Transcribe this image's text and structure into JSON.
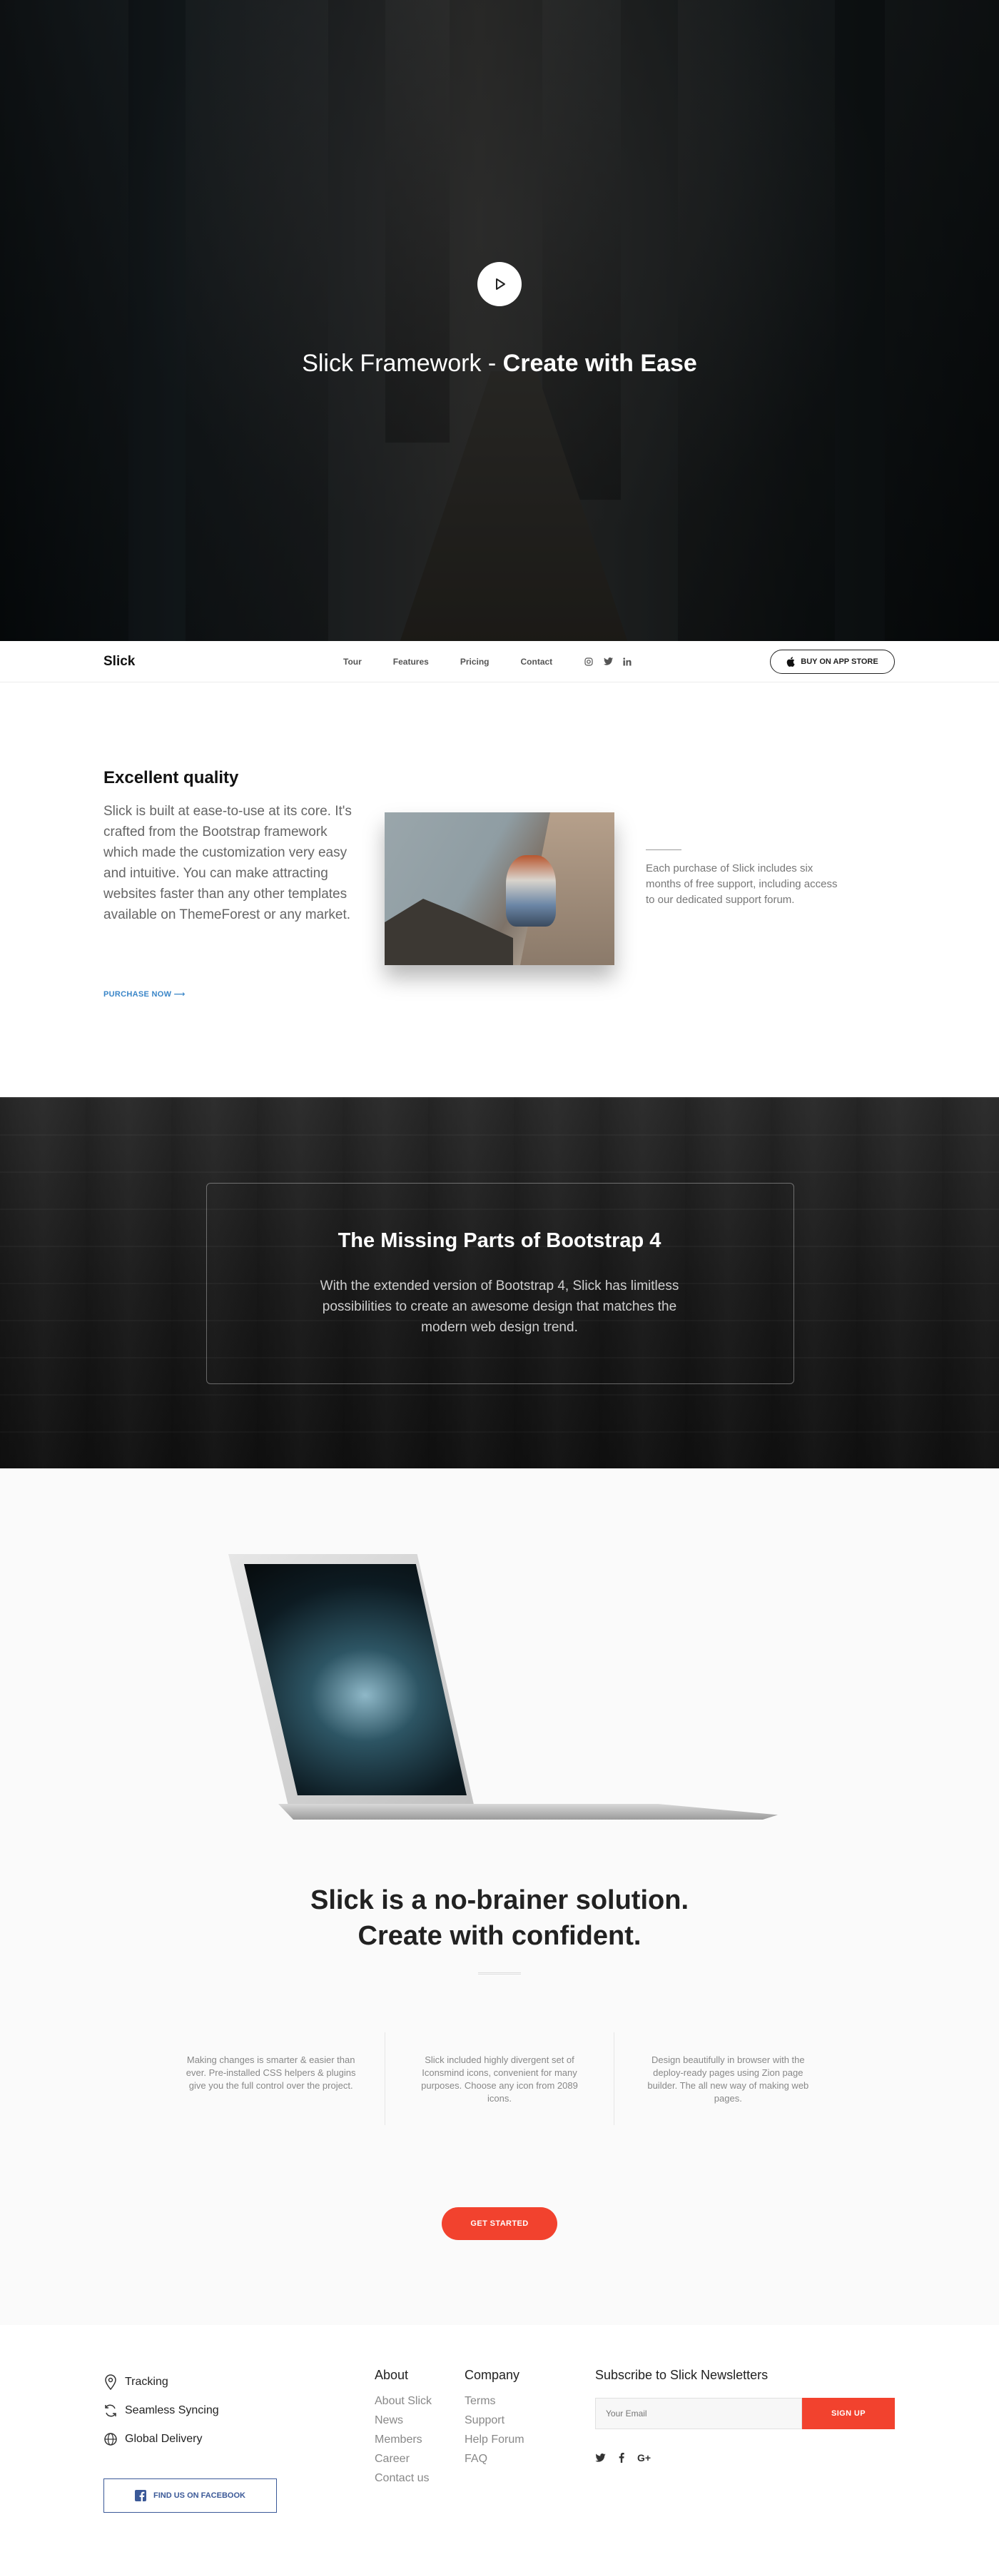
{
  "hero": {
    "title_light": "Slick Framework - ",
    "title_bold": "Create with Ease",
    "play_icon": "play-icon"
  },
  "nav": {
    "brand": "Slick",
    "links": [
      "Tour",
      "Features",
      "Pricing",
      "Contact"
    ],
    "social_icons": [
      "instagram-icon",
      "twitter-icon",
      "linkedin-icon"
    ],
    "app_button": "BUY ON APP STORE"
  },
  "quality": {
    "title": "Excellent quality",
    "body": "Slick is built at ease-to-use at its core. It's crafted from the Bootstrap framework which made the customization very easy and intuitive. You can make attracting websites faster than any other templates available on ThemeForest or any market.",
    "link": "PURCHASE NOW ⟶",
    "side_text": "Each purchase of Slick includes six months of free support, including access to our dedicated support forum."
  },
  "bootstrap": {
    "title_light": "The Missing Parts of ",
    "title_bold": "Bootstrap 4",
    "body": "With the extended version of Bootstrap 4, Slick has limitless possibilities to create an awesome design that matches the modern web design trend."
  },
  "solution": {
    "line1": "Slick is a no-brainer solution.",
    "line2": "Create with confident.",
    "features": [
      "Making changes is smarter & easier than ever. Pre-installed CSS helpers & plugins give you the full control over the project.",
      "Slick included highly divergent set of Iconsmind icons, convenient for many purposes. Choose any icon from 2089 icons.",
      "Design beautifully in browser with the deploy-ready pages using Zion page builder. The all new way of making web pages."
    ],
    "cta": "GET STARTED"
  },
  "footer": {
    "features": [
      {
        "icon": "map-pin-icon",
        "label": "Tracking"
      },
      {
        "icon": "sync-icon",
        "label": "Seamless Syncing"
      },
      {
        "icon": "globe-icon",
        "label": "Global Delivery"
      }
    ],
    "facebook_button": "FIND US ON FACEBOOK",
    "about": {
      "title": "About",
      "links": [
        "About Slick",
        "News",
        "Members",
        "Career",
        "Contact us"
      ]
    },
    "company": {
      "title": "Company",
      "links": [
        "Terms",
        "Support",
        "Help Forum",
        "FAQ"
      ]
    },
    "subscribe_title": "Subscribe to Slick Newsletters",
    "email_placeholder": "Your Email",
    "signup": "SIGN UP",
    "social_icons": [
      "twitter-icon",
      "facebook-icon",
      "google-plus-icon"
    ],
    "google_plus_text": "G+"
  },
  "colors": {
    "accent": "#f2422e",
    "link": "#3a86c8",
    "facebook": "#3b5998"
  }
}
